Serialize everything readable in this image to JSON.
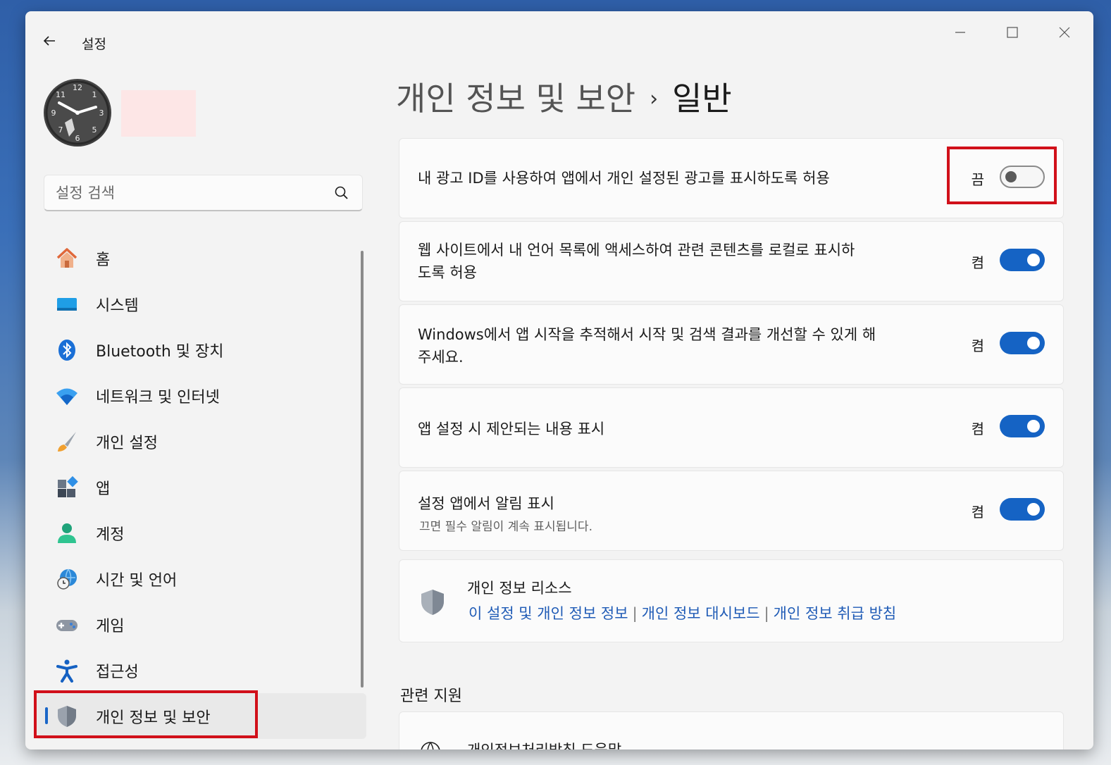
{
  "window": {
    "title": "설정"
  },
  "profile": {
    "avatar_label": "사용자 프로필 사진"
  },
  "search": {
    "placeholder": "설정 검색"
  },
  "sidebar": {
    "items": [
      {
        "label": "홈",
        "icon": "home-icon"
      },
      {
        "label": "시스템",
        "icon": "system-icon"
      },
      {
        "label": "Bluetooth 및 장치",
        "icon": "bluetooth-icon"
      },
      {
        "label": "네트워크 및 인터넷",
        "icon": "wifi-icon"
      },
      {
        "label": "개인 설정",
        "icon": "brush-icon"
      },
      {
        "label": "앱",
        "icon": "apps-icon"
      },
      {
        "label": "계정",
        "icon": "account-icon"
      },
      {
        "label": "시간 및 언어",
        "icon": "globe-clock-icon"
      },
      {
        "label": "게임",
        "icon": "gamepad-icon"
      },
      {
        "label": "접근성",
        "icon": "accessibility-icon"
      },
      {
        "label": "개인 정보 및 보안",
        "icon": "shield-icon",
        "active": true
      }
    ]
  },
  "breadcrumb": {
    "parent": "개인 정보 및 보안",
    "separator": "›",
    "current": "일반"
  },
  "settings": [
    {
      "label": "내 광고 ID를 사용하여 앱에서 개인 설정된 광고를 표시하도록 허용",
      "state": "끔",
      "on": false
    },
    {
      "label_line1": "웹 사이트에서 내 언어 목록에 액세스하여 관련 콘텐츠를 로컬로 표시하",
      "label_line2": "도록 허용",
      "state": "켬",
      "on": true
    },
    {
      "label_line1": "Windows에서 앱 시작을 추적해서 시작 및 검색 결과를 개선할 수 있게 해",
      "label_line2": "주세요.",
      "state": "켬",
      "on": true
    },
    {
      "label": "앱 설정 시 제안되는 내용 표시",
      "state": "켬",
      "on": true
    },
    {
      "label": "설정 앱에서 알림 표시",
      "description": "끄면 필수 알림이 계속 표시됩니다.",
      "state": "켬",
      "on": true
    }
  ],
  "resources": {
    "title": "개인 정보 리소스",
    "links": [
      "이 설정 및 개인 정보 정보",
      "개인 정보 대시보드",
      "개인 정보 취급 방침"
    ],
    "divider": "|"
  },
  "related": {
    "title": "관련 지원",
    "partial_item": "개인정보처리방침 도움말"
  },
  "colors": {
    "accent": "#1563c4",
    "highlight": "#d1101a",
    "link": "#1f5bb6"
  }
}
